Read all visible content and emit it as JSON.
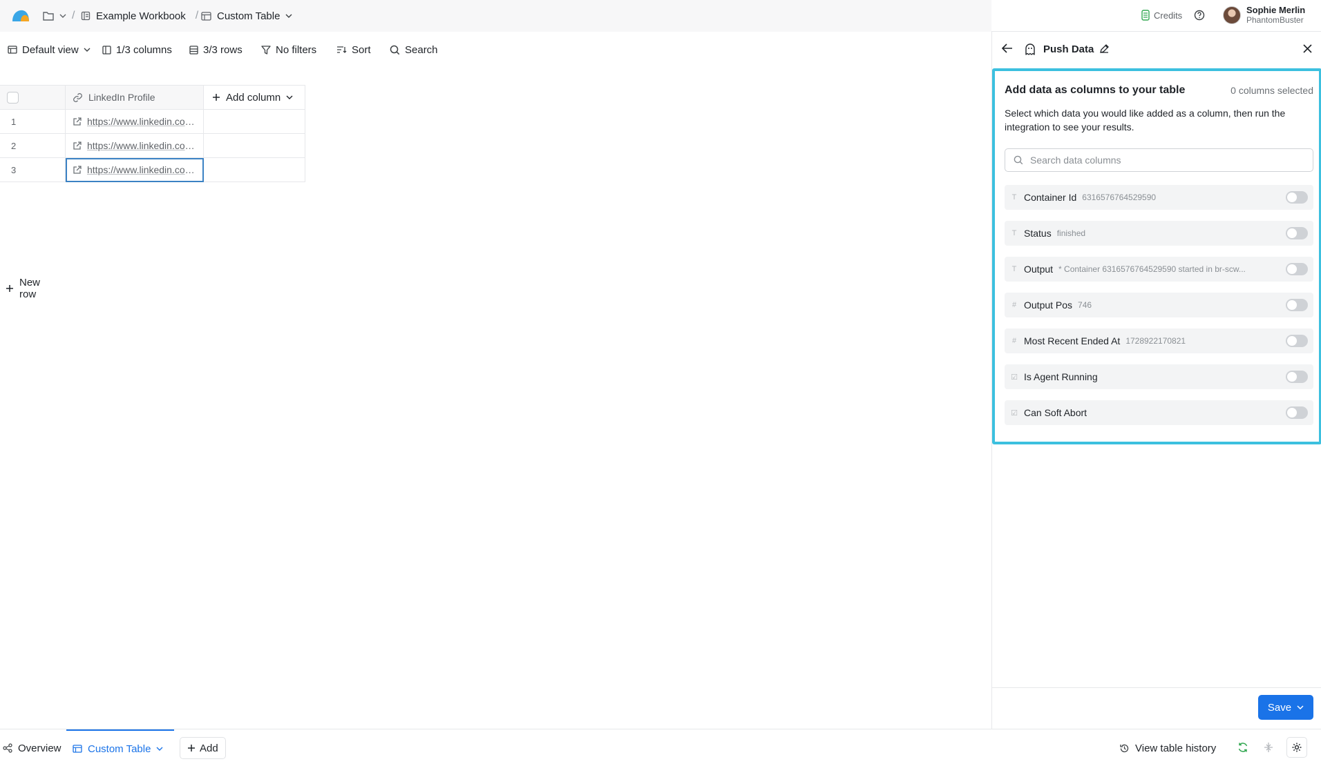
{
  "breadcrumb": {
    "workbook": "Example Workbook",
    "table": "Custom Table",
    "separator": "/"
  },
  "header": {
    "credits_label": "Credits",
    "user_name": "Sophie Merlin",
    "user_org": "PhantomBuster"
  },
  "toolbar": {
    "view": "Default view",
    "columns": "1/3 columns",
    "rows": "3/3 rows",
    "filters": "No filters",
    "sort": "Sort",
    "search": "Search"
  },
  "table": {
    "column_header": "LinkedIn Profile",
    "add_column": "Add column",
    "rows": [
      {
        "index": "1",
        "url": "https://www.linkedin.com/in/"
      },
      {
        "index": "2",
        "url": "https://www.linkedin.com/in/"
      },
      {
        "index": "3",
        "url": "https://www.linkedin.com/in/"
      }
    ],
    "new_row": "New row"
  },
  "panel": {
    "title": "Push Data",
    "section_title": "Add data as columns to your table",
    "selected_count": "0 columns selected",
    "description": "Select which data you would like added as a column, then run the integration to see your results.",
    "search_placeholder": "Search data columns",
    "options": [
      {
        "type": "T",
        "name": "Container Id",
        "value": "6316576764529590",
        "enabled": false
      },
      {
        "type": "T",
        "name": "Status",
        "value": "finished",
        "enabled": false
      },
      {
        "type": "T",
        "name": "Output",
        "value": "* Container 6316576764529590 started in br-scw...",
        "enabled": false
      },
      {
        "type": "#",
        "name": "Output Pos",
        "value": "746",
        "enabled": false
      },
      {
        "type": "#",
        "name": "Most Recent Ended At",
        "value": "1728922170821",
        "enabled": false
      },
      {
        "type": "☑",
        "name": "Is Agent Running",
        "value": "",
        "enabled": false
      },
      {
        "type": "☑",
        "name": "Can Soft Abort",
        "value": "",
        "enabled": false
      }
    ],
    "save_label": "Save"
  },
  "bottom": {
    "overview": "Overview",
    "active_tab": "Custom Table",
    "add_label": "Add",
    "history": "View table history"
  },
  "colors": {
    "accent": "#1a73e8",
    "highlight_border": "#3cc0df"
  }
}
